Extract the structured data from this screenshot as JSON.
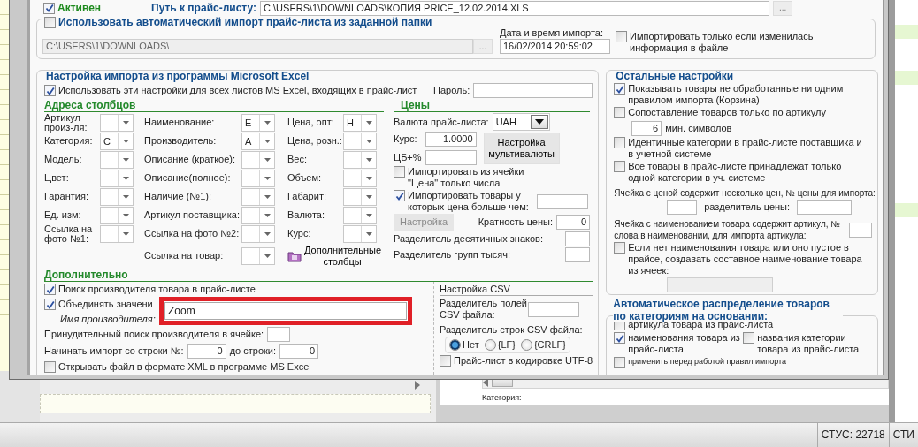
{
  "active": {
    "label": "Активен",
    "checked": true
  },
  "path": {
    "label": "Путь к прайс-листу:",
    "value": "C:\\USERS\\1\\DOWNLOADS\\КОПИЯ PRICE_12.02.2014.XLS",
    "button": "..."
  },
  "auto_import": {
    "label": "Использовать автоматический импорт прайс-листа из заданной папки",
    "checked": false,
    "folder": "C:\\USERS\\1\\DOWNLOADS\\",
    "button": "...",
    "date_label": "Дата и время импорта:",
    "date": "16/02/2014 20:59:02",
    "only_changed": {
      "label": "Импортировать только если изменилась информация в файле",
      "checked": false
    }
  },
  "excel": {
    "title": "Настройка импорта из программы Microsoft Excel",
    "all_sheets": {
      "label": "Использовать эти настройки для всех листов MS Excel, входящих в прайс-лист",
      "checked": true
    },
    "password_label": "Пароль:",
    "columns_title": "Адреса столбцов",
    "columns": [
      [
        {
          "label": "Артикул произ-ля:"
        },
        {
          "label": "Категория:",
          "value": "C"
        },
        {
          "label": "Модель:"
        },
        {
          "label": "Цвет:"
        },
        {
          "label": "Гарантия:"
        },
        {
          "label": "Ед. изм:"
        },
        {
          "label": "Ссылка на фото №1:"
        }
      ],
      [
        {
          "label": "Наименование:",
          "value": "E"
        },
        {
          "label": "Производитель:",
          "value": "A"
        },
        {
          "label": "Описание (краткое):"
        },
        {
          "label": "Описание(полное):"
        },
        {
          "label": "Наличие (№1):"
        },
        {
          "label": "Артикул поставщика:"
        },
        {
          "label": "Ссылка на фото №2:"
        },
        {
          "label": "Ссылка на товар:"
        }
      ],
      [
        {
          "label": "Цена, опт:",
          "value": "H"
        },
        {
          "label": "Цена, розн.:"
        },
        {
          "label": "Вес:"
        },
        {
          "label": "Объем:"
        },
        {
          "label": "Габарит:"
        },
        {
          "label": "Валюта:"
        },
        {
          "label": "Курс:"
        }
      ]
    ],
    "extra_columns_button": "Дополнительные столбцы",
    "prices": {
      "title": "Цены",
      "currency_label": "Валюта прайс-листа:",
      "currency": "UAH",
      "rate_label": "Курс:",
      "rate": "1.0000",
      "multicurrency_button": "Настройка мультивалюты",
      "cb_label": "ЦБ+%",
      "numbers_only": {
        "label": "Импортировать из ячейки \"Цена\" только числа",
        "checked": false
      },
      "min_price": {
        "label": "Импортировать товары у которых цена больше чем:",
        "checked": true
      },
      "settings_button": {
        "label": "Настройка",
        "disabled": true
      },
      "multiple_label": "Кратность цены:",
      "multiple": "0",
      "decimal_label": "Разделитель десятичных знаков:",
      "thousands_label": "Разделитель групп тысяч:"
    },
    "additional": {
      "title": "Дополнительно",
      "find_maker": {
        "label": "Поиск производителя товара в прайс-листе",
        "checked": true
      },
      "merge": {
        "label": "Объединять значени",
        "checked": true
      },
      "maker_name_label": "Имя производителя:",
      "forced_label": "Принудительный поиск производителя в ячейке:",
      "start_label": "Начинать импорт со строки №:",
      "start": "0",
      "end_label": "до строки:",
      "end": "0",
      "xml": {
        "label": "Открывать файл в формате XML в программе MS Excel",
        "checked": false
      }
    },
    "csv": {
      "title": "Настройка CSV",
      "field_sep_label": "Разделитель полей CSV файла:",
      "row_sep_label": "Разделитель строк CSV файла:",
      "row_sep": [
        {
          "label": "Нет",
          "selected": true
        },
        {
          "label": "{LF}",
          "selected": false
        },
        {
          "label": "{CRLF}",
          "selected": false
        }
      ],
      "utf8": {
        "label": "Прайс-лист в кодировке UTF-8",
        "checked": false
      }
    }
  },
  "other": {
    "title": "Остальные настройки",
    "show_basket": {
      "label": "Показывать товары не обработанные ни одним правилом импорта (Корзина)",
      "checked": true
    },
    "by_article": {
      "label": "Сопоставление товаров только по артикулу",
      "checked": false
    },
    "min_chars": "6",
    "min_chars_label": "мин. символов",
    "same_categories": {
      "label": "Идентичные категории в прайс-листе поставщика и в учетной системе",
      "checked": false
    },
    "one_category": {
      "label": "Все товары в прайс-листе принадлежат только одной категории в уч. системе",
      "checked": false
    },
    "multi_price_label": "Ячейка с ценой содержит несколько цен, № цены для импорта:",
    "price_sep_label": "разделитель цены:",
    "article_in_name_label": "Ячейка с наименованием товара содержит артикул, № слова в наименовании, для импорта артикула:",
    "compose_name": {
      "label": "Если нет наименования товара или оно пустое в прайсе, создавать составное наименование товара из ячеек:",
      "checked": false
    }
  },
  "auto_category": {
    "title": "Автоматическое распределение товаров по категориям на основании:",
    "options": [
      {
        "label": "артикула товара из прайс-листа",
        "checked": false
      },
      {
        "label": "наименования товара из прайс-листа",
        "checked": true
      },
      {
        "label": "названия  категории товара из прайс-листа",
        "checked": false
      },
      {
        "label": "применить перед работой правил импорта",
        "checked": false
      }
    ]
  },
  "zoom_overlay": {
    "value": "Zoom"
  },
  "sheet": {
    "category_label": "Категория:"
  },
  "status_bar": {
    "items": [
      "СТУС: 22718",
      "СТИ"
    ]
  }
}
